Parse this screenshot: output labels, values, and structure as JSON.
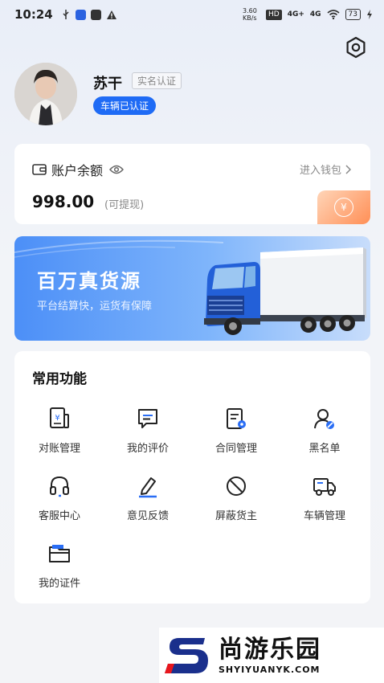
{
  "status_bar": {
    "time": "10:24",
    "speed": "3.60 KB/s",
    "hd": "HD",
    "net1": "4G+",
    "net2": "4G",
    "battery": "73"
  },
  "profile": {
    "name": "苏干",
    "realname_tag": "实名认证",
    "vehicle_badge": "车辆已认证"
  },
  "wallet": {
    "title": "账户余额",
    "link": "进入钱包",
    "balance": "998.00",
    "note": "(可提现)",
    "coin_symbol": "¥"
  },
  "banner": {
    "title": "百万真货源",
    "subtitle": "平台结算快，运货有保障"
  },
  "functions": {
    "title": "常用功能",
    "items": [
      {
        "label": "对账管理",
        "icon": "statement-icon"
      },
      {
        "label": "我的评价",
        "icon": "comment-icon"
      },
      {
        "label": "合同管理",
        "icon": "contract-icon"
      },
      {
        "label": "黑名单",
        "icon": "blacklist-icon"
      },
      {
        "label": "客服中心",
        "icon": "headset-icon"
      },
      {
        "label": "意见反馈",
        "icon": "pen-icon"
      },
      {
        "label": "屏蔽货主",
        "icon": "block-icon"
      },
      {
        "label": "车辆管理",
        "icon": "truck-icon"
      },
      {
        "label": "我的证件",
        "icon": "folder-icon"
      }
    ]
  },
  "watermark": {
    "cn": "尚游乐园",
    "en": "SHYIYUANYK.COM"
  },
  "colors": {
    "accent": "#1f6bf5",
    "orange": "#ff8f56"
  }
}
